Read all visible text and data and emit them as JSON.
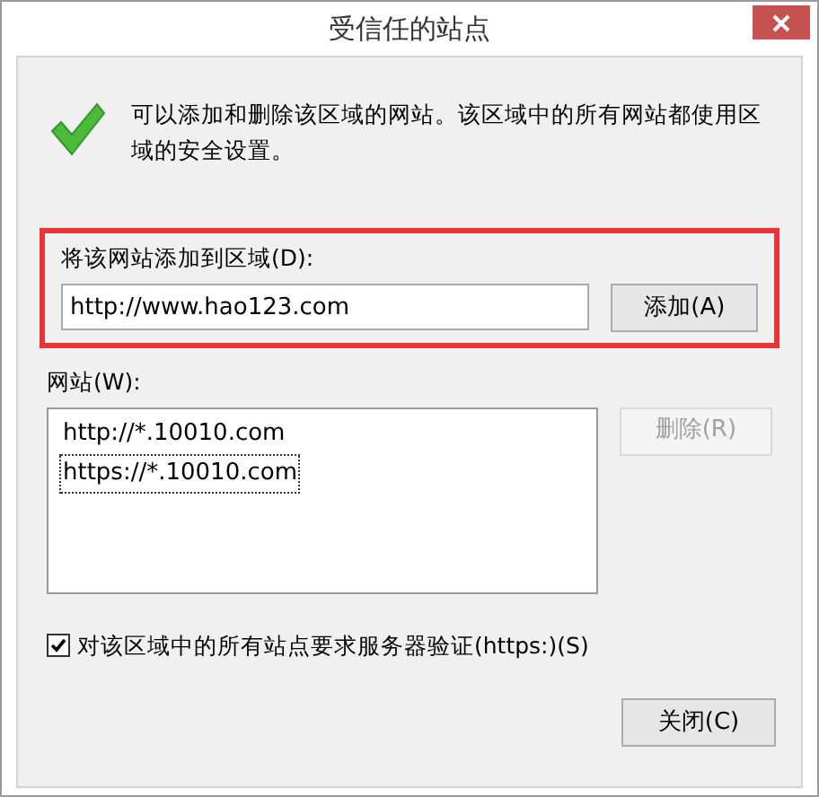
{
  "window": {
    "title": "受信任的站点"
  },
  "message": "可以添加和删除该区域的网站。该区域中的所有网站都使用区域的安全设置。",
  "add_section": {
    "label": "将该网站添加到区域(D):",
    "value": "http://www.hao123.com",
    "button": {
      "label": "添加(A)",
      "disabled": false
    }
  },
  "sites": {
    "label": "网站(W):",
    "items": [
      {
        "text": "http://*.10010.com",
        "focused": false
      },
      {
        "text": "https://*.10010.com",
        "focused": true
      }
    ],
    "remove_button": {
      "label": "删除(R)",
      "disabled": true
    }
  },
  "https_check": {
    "label": "对该区域中的所有站点要求服务器验证(https:)(S)",
    "checked": true
  },
  "close_button": {
    "label": "关闭(C)",
    "disabled": false
  }
}
